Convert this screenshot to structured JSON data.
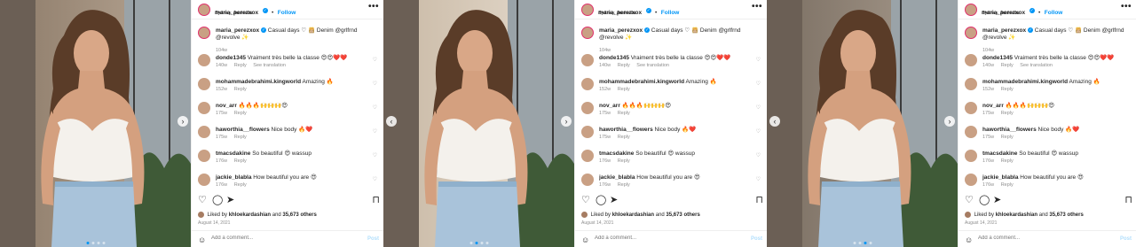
{
  "post": {
    "username": "maria_perezxox",
    "location": "Sydney, Australia",
    "follow_label": "Follow",
    "more_label": "•••",
    "caption": "Casual days ♡ 👸🏼 Denim @grlfrnd @revolve ✨",
    "caption_time": "104w",
    "likes_prefix": "Liked by",
    "likes_user": "khloekardashian",
    "likes_and": "and",
    "likes_count": "35,673 others",
    "date": "August 14, 2021",
    "add_comment_placeholder": "Add a comment...",
    "post_label": "Post"
  },
  "comments": [
    {
      "user": "donde1345",
      "text": "Vraiment très belle la classe 😍😍❤️❤️",
      "time": "140w",
      "reply": "Reply",
      "extra": "See translation"
    },
    {
      "user": "mohammadebrahimi.kingworld",
      "text": "Amazing 🔥",
      "time": "152w",
      "reply": "Reply",
      "extra": ""
    },
    {
      "user": "nov_arr",
      "text": "🔥🔥🔥🙌🙌🙌😍",
      "time": "175w",
      "reply": "Reply",
      "extra": ""
    },
    {
      "user": "haworthia__flowers",
      "text": "Nice body 🔥❤️",
      "time": "175w",
      "reply": "Reply",
      "extra": ""
    },
    {
      "user": "tmacsdakine",
      "text": "So beautiful 😍 wassup",
      "time": "176w",
      "reply": "Reply",
      "extra": ""
    },
    {
      "user": "jackie_blabla",
      "text": "How beautiful you are 😍",
      "time": "176w",
      "reply": "Reply",
      "extra": ""
    }
  ],
  "icons": {
    "heart": "♡",
    "comment": "◯",
    "share": "➤",
    "bookmark": "⊓",
    "emoji": "☺",
    "verified": "✓",
    "prev": "‹",
    "next": "›"
  },
  "colors": {
    "accent": "#0095f6",
    "muted": "#8e8e8e",
    "text": "#262626"
  }
}
